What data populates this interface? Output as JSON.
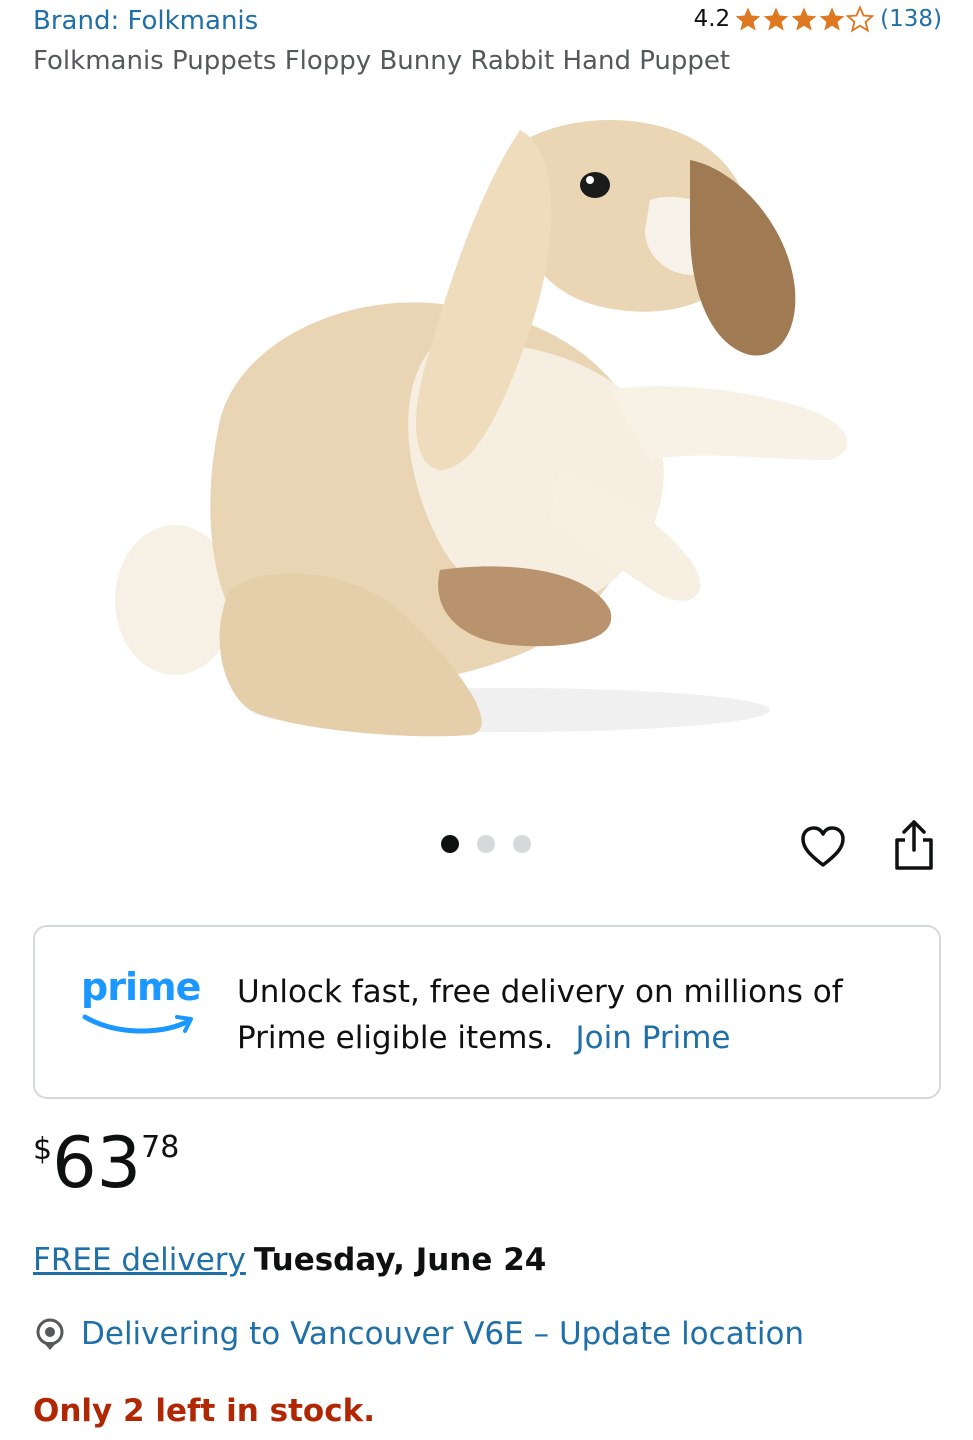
{
  "header": {
    "brand_link": "Brand: Folkmanis",
    "rating_value": "4.2",
    "rating_stars": 4.2,
    "rating_count": "(138)",
    "title": "Folkmanis Puppets Floppy Bunny Rabbit Hand Puppet"
  },
  "gallery": {
    "image_alt": "Folkmanis Puppets Floppy Bunny Rabbit Hand Puppet",
    "dots_count": 3,
    "active_dot": 1
  },
  "actions": {
    "wishlist_icon": "heart-icon",
    "share_icon": "share-icon"
  },
  "prime_banner": {
    "logo_text": "prime",
    "message": "Unlock fast, free delivery on millions of Prime eligible items.",
    "join_link": "Join Prime"
  },
  "price": {
    "currency": "$",
    "whole": "63",
    "fraction": "78"
  },
  "delivery": {
    "free_link": "FREE delivery",
    "date": "Tuesday, June 24"
  },
  "location": {
    "icon": "location-pin-icon",
    "text": "Delivering to Vancouver V6E – Update location"
  },
  "stock": {
    "text": "Only 2 left in stock."
  },
  "colors": {
    "link_blue": "#1f6fa8",
    "prime_blue": "#1a98ff",
    "star_orange": "#de7921",
    "stock_red": "#b12704"
  }
}
